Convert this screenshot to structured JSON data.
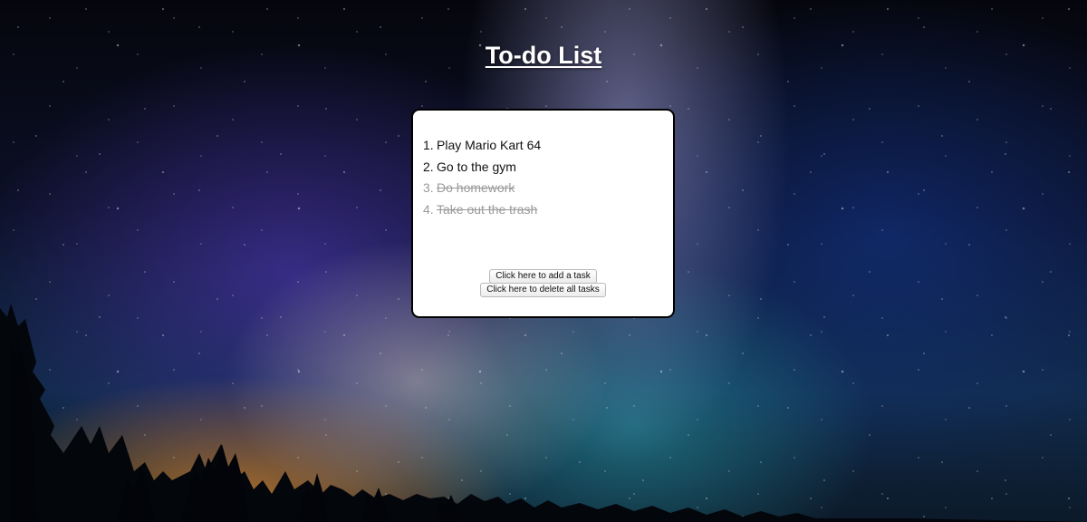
{
  "page": {
    "title": "To-do List"
  },
  "tasks": [
    {
      "number": "1.",
      "text": "Play Mario Kart 64",
      "done": false
    },
    {
      "number": "2.",
      "text": "Go to the gym",
      "done": false
    },
    {
      "number": "3.",
      "text": "Do homework",
      "done": true
    },
    {
      "number": "4.",
      "text": "Take out the trash",
      "done": true
    }
  ],
  "actions": {
    "add_label": "Click here to add a task",
    "delete_label": "Click here to delete all tasks"
  },
  "colors": {
    "title_text": "#ffffff",
    "card_background": "#ffffff",
    "task_active": "#111111",
    "task_done": "#9a9a9a"
  },
  "background": {
    "description_icon": "starry-night-sky-background"
  }
}
